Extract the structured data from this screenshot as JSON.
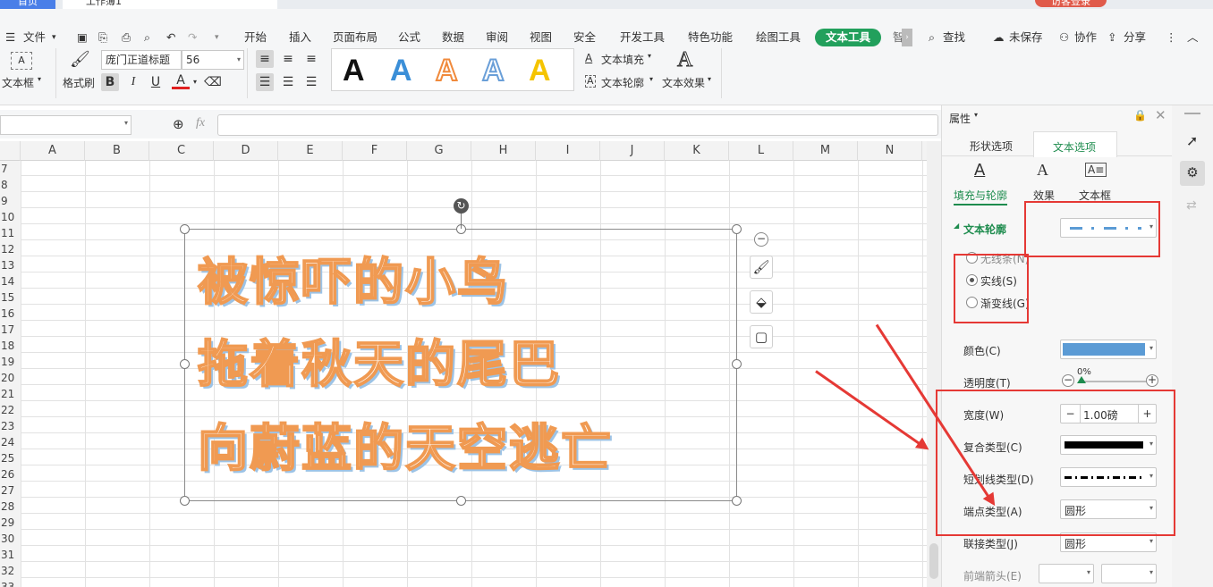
{
  "tabs": {
    "home": "首页",
    "workbook": "工作簿1",
    "login": "访客登录"
  },
  "menu": {
    "file": "文件",
    "items": [
      "开始",
      "插入",
      "页面布局",
      "公式",
      "数据",
      "审阅",
      "视图",
      "安全",
      "开发工具",
      "特色功能",
      "绘图工具"
    ],
    "active": "文本工具",
    "truncated": "智",
    "search": "查找",
    "unsaved": "未保存",
    "collab": "协作",
    "share": "分享"
  },
  "ribbon": {
    "textbox_label": "文本框",
    "format_painter": "格式刷",
    "font_name": "庞门正道标题",
    "font_size": "56",
    "bold": "B",
    "italic": "I",
    "underline": "U",
    "font_color": "A",
    "text_fill": "文本填充",
    "text_outline": "文本轮廓",
    "text_effect": "文本效果",
    "style_glyph": "A",
    "style_colors": [
      "#111111",
      "#3b8fd8",
      "#f08a3c",
      "#6a9fd8",
      "#f5c400"
    ]
  },
  "formula": {
    "fx": "fx"
  },
  "sheet": {
    "columns": [
      "A",
      "B",
      "C",
      "D",
      "E",
      "F",
      "G",
      "H",
      "I",
      "J",
      "K",
      "L",
      "M",
      "N"
    ],
    "rows": [
      "7",
      "8",
      "9",
      "10",
      "11",
      "12",
      "13",
      "14",
      "15",
      "16",
      "17",
      "18",
      "19",
      "20",
      "21",
      "22",
      "23",
      "24",
      "25",
      "26",
      "27",
      "28",
      "29",
      "30",
      "31",
      "32",
      "33"
    ]
  },
  "textbox": {
    "lines": [
      "被惊吓的小鸟",
      "拖着秋天的尾巴",
      "向蔚蓝的天空逃亡"
    ]
  },
  "panel": {
    "title": "属性",
    "tab_shape": "形状选项",
    "tab_text": "文本选项",
    "sub_fill": "填充与轮廓",
    "sub_effect": "效果",
    "sub_textbox": "文本框",
    "section": "文本轮廓",
    "no_line": "无线条(N)",
    "solid": "实线(S)",
    "gradient": "渐变线(G)",
    "color_label": "颜色(C)",
    "color_value": "#5b9bd5",
    "transparency_label": "透明度(T)",
    "transparency_value": "0%",
    "width_label": "宽度(W)",
    "width_value": "1.00磅",
    "compound_label": "复合类型(C)",
    "dash_label": "短划线类型(D)",
    "cap_label": "端点类型(A)",
    "cap_value": "圆形",
    "join_label": "联接类型(J)",
    "join_value": "圆形",
    "arrow_label": "前端箭头(E)"
  }
}
